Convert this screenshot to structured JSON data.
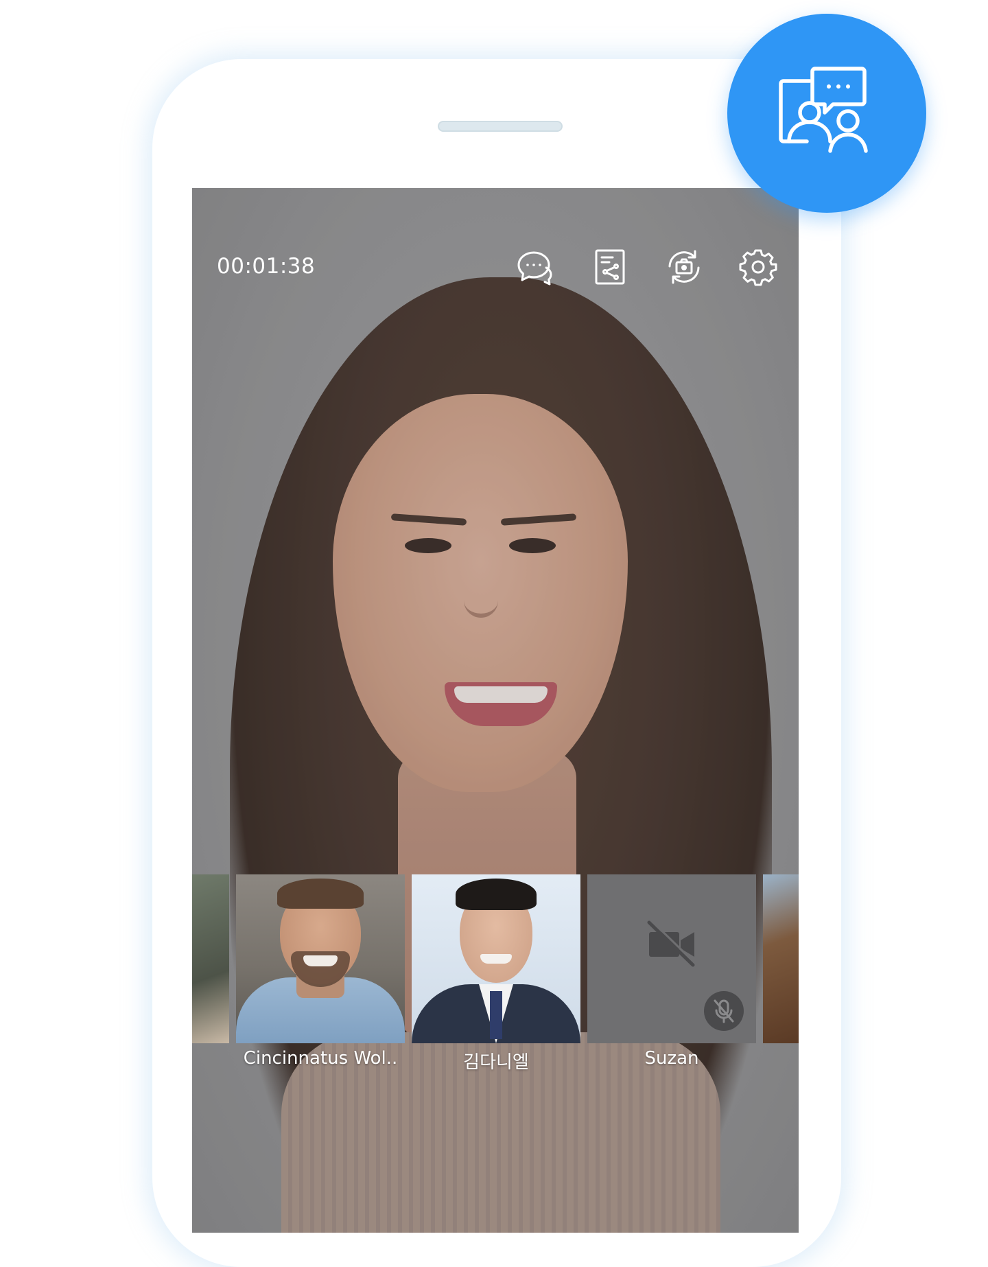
{
  "call": {
    "timer": "00:01:38"
  },
  "toolbar": {
    "icons": [
      "chat-icon",
      "share-document-icon",
      "switch-camera-icon",
      "settings-gear-icon"
    ]
  },
  "participants": [
    {
      "name": "Cincinnatus Wol.."
    },
    {
      "name": "김다니엘"
    },
    {
      "name": "Suzan",
      "video": "off",
      "mic": "muted"
    }
  ],
  "badge": {
    "icon": "group-chat-icon",
    "color": "#2f96f5"
  }
}
